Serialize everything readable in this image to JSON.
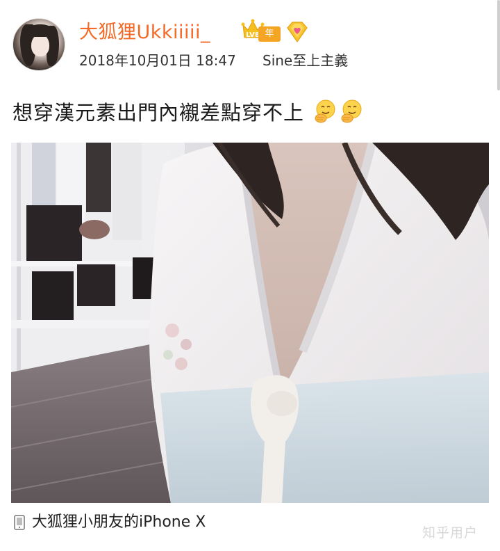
{
  "post": {
    "author": {
      "name": "大狐狸Ukkiiiii_",
      "level_badge": "LV8",
      "annual_badge": "年",
      "avatar_icon": "avatar-photo",
      "name_color": "#f26a26"
    },
    "timestamp": "2018年10月01日 18:47",
    "source": "Sine至上主義",
    "text": "想穿漢元素出門內襯差點穿不上",
    "emojis": [
      "thinking-hands-emoji",
      "thinking-hands-emoji"
    ],
    "device": {
      "icon": "phone-icon",
      "label": "大狐狸小朋友的iPhone X"
    }
  },
  "watermark": "知乎用户"
}
